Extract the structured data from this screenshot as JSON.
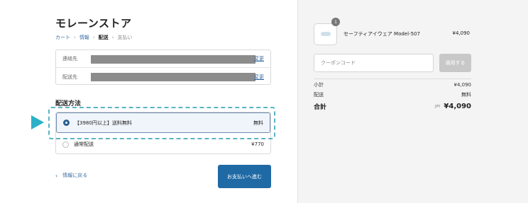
{
  "store": {
    "title": "モレーンストア"
  },
  "breadcrumb": {
    "items": [
      {
        "label": "カート",
        "state": "done"
      },
      {
        "label": "情報",
        "state": "link"
      },
      {
        "label": "配送",
        "state": "current"
      },
      {
        "label": "支払い",
        "state": "future"
      }
    ],
    "separator": "›"
  },
  "info": {
    "contact_label": "連絡先",
    "contact_change": "変更",
    "address_label": "配送先",
    "address_change": "変更"
  },
  "shipping": {
    "heading": "配送方法",
    "options": [
      {
        "label": "【3980円以上】送料無料",
        "price": "無料",
        "selected": true
      },
      {
        "label": "通常配送",
        "price": "¥770",
        "selected": false
      }
    ]
  },
  "nav": {
    "back_label": "情報に戻る",
    "back_icon": "chevron-left-icon",
    "pay_label": "お支払いへ進む"
  },
  "cart": {
    "quantity": "1",
    "product_name": "セーフティアイウェア Model-507",
    "product_price": "¥4,090"
  },
  "coupon": {
    "placeholder": "クーポンコード",
    "apply_label": "適用する"
  },
  "summary": {
    "subtotal_label": "小計",
    "subtotal_value": "¥4,090",
    "shipping_label": "配送",
    "shipping_value": "無料",
    "total_label": "合計",
    "total_currency": "JPY",
    "total_value": "¥4,090"
  },
  "colors": {
    "accent": "#1f6aa5",
    "link": "#3b6fa6",
    "highlight_dash": "#59b5c3",
    "arrow": "#2ab0c8"
  }
}
